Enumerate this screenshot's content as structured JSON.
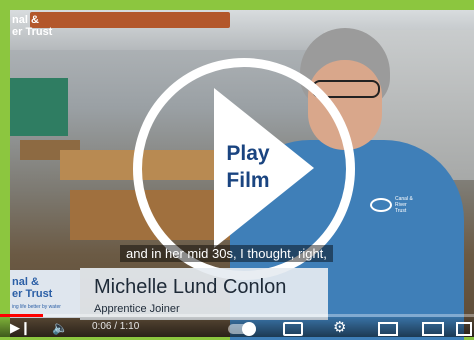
{
  "video": {
    "title_overlay": "Play Film",
    "brand_top": "nal &\ner Trust",
    "subtitle": "and in her mid 30s, I thought, right,",
    "lower_third": {
      "brand": "nal &\ner Trust",
      "brand_tag": "ing life better by water",
      "name": "Michelle Lund Conlon",
      "role": "Apprentice Joiner"
    },
    "shirt_logo_text": "Canal & River Trust",
    "progress": 0.09
  },
  "controls": {
    "time": "0:06 / 1:10",
    "next_icon": "next-icon",
    "volume_icon": "volume-icon",
    "autoplay_icon": "autoplay-toggle-icon",
    "subtitles_icon": "subtitles-icon",
    "settings_icon": "settings-icon",
    "miniplayer_icon": "miniplayer-icon",
    "theater_icon": "theater-icon",
    "fullscreen_icon": "fullscreen-icon"
  },
  "colors": {
    "page_bg": "#8cc63f",
    "play_text": "#1a4480",
    "progress": "#ff0000"
  }
}
